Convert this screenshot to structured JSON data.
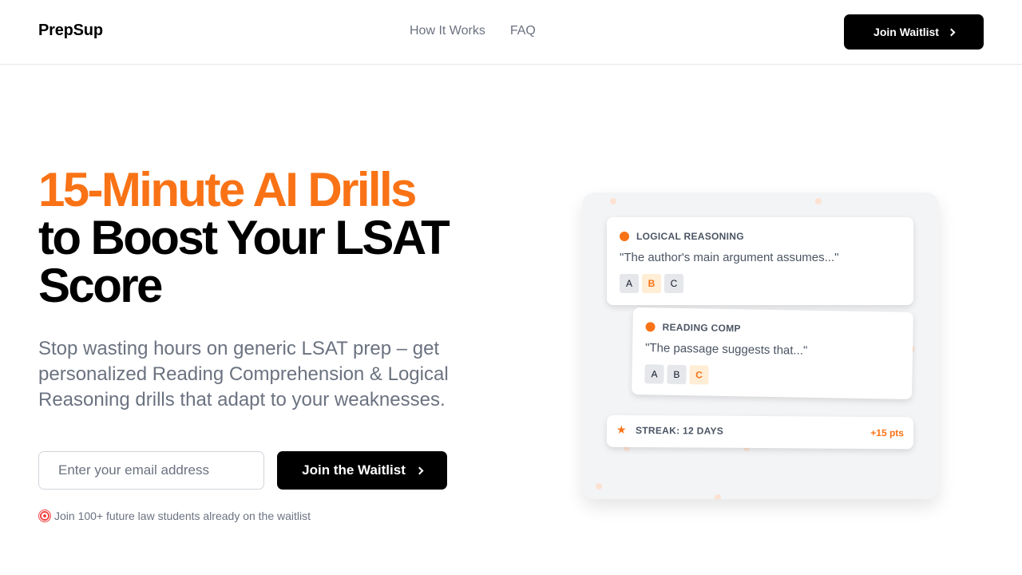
{
  "header": {
    "logo": "PrepSup",
    "nav": [
      "How It Works",
      "FAQ"
    ],
    "cta_label": "Join Waitlist"
  },
  "hero": {
    "headline_accent": "15-Minute AI Drills",
    "headline_rest": "to Boost Your LSAT Score",
    "subtitle": "Stop wasting hours on generic LSAT prep – get personalized Reading Comprehension & Logical Reasoning drills that adapt to your weaknesses.",
    "email_placeholder": "Enter your email address",
    "cta_label": "Join the Waitlist",
    "social_proof": "Join 100+ future law students already on the waitlist"
  },
  "illustration": {
    "card1": {
      "title": "LOGICAL REASONING",
      "quote": "\"The author's main argument assumes...\"",
      "options": [
        "A",
        "B",
        "C"
      ],
      "selected": "B"
    },
    "card2": {
      "title": "READING COMP",
      "quote": "\"The passage suggests that...\"",
      "options": [
        "A",
        "B",
        "C"
      ],
      "selected": "C"
    },
    "streak": {
      "label": "STREAK: 12 DAYS",
      "points": "+15 pts"
    }
  },
  "colors": {
    "accent": "#f97316",
    "primary_button": "#000000",
    "muted_text": "#6b7280"
  },
  "icons": [
    "chevron-right-icon",
    "target-icon",
    "star-icon"
  ]
}
